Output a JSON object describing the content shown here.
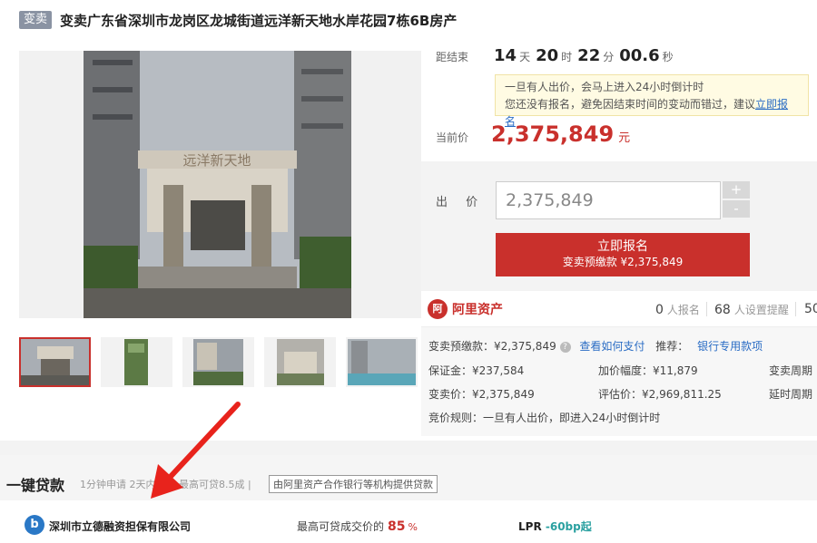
{
  "header": {
    "badge": "变卖",
    "title": "变卖广东省深圳市龙岗区龙城街道远洋新天地水岸花园7栋6B房产"
  },
  "photo": {
    "sign_text": "远洋新天地"
  },
  "countdown": {
    "label": "距结束",
    "days": "14",
    "days_unit": "天",
    "hours": "20",
    "hours_unit": "时",
    "minutes": "22",
    "minutes_unit": "分",
    "seconds": "00.6",
    "seconds_unit": "秒"
  },
  "notice": {
    "line1": "一旦有人出价，会马上进入24小时倒计时",
    "line2": "您还没有报名，避免因结束时间的变动而错过，建议",
    "link": "立即报名"
  },
  "current_price": {
    "label": "当前价",
    "value": "2,375,849",
    "unit": "元"
  },
  "bid": {
    "label": "出 价",
    "input_value": "2,375,849",
    "plus": "+",
    "minus": "-",
    "signup_label": "立即报名",
    "deposit_text": "变卖预缴款 ¥2,375,849"
  },
  "ali": {
    "logo": "阿",
    "name": "阿里资产",
    "signups_value": "0",
    "signups_label": "人报名",
    "reminders_value": "68",
    "reminders_label": "人设置提醒",
    "views_value": "50"
  },
  "details": {
    "prepay_label": "变卖预缴款：¥2,375,849",
    "help_icon": "?",
    "pay_link": "查看如何支付",
    "recommend_label": "推荐：",
    "bank_link": "银行专用款项",
    "deposit": "保证金：¥237,584",
    "increment": "加价幅度：¥11,879",
    "period": "变卖周期",
    "sale_price": "变卖价：¥2,375,849",
    "appraisal": "评估价：¥2,969,811.25",
    "extension": "延时周期",
    "rules": "竞价规则：一旦有人出价，即进入24小时倒计时"
  },
  "loan": {
    "title": "一键贷款",
    "subtitle": "1分钟申请 2天内放款 最高可贷8.5成 |",
    "tag": "由阿里资产合作银行等机构提供贷款",
    "logo": "b",
    "company": "深圳市立德融资担保有限公司",
    "max_label": "最高可贷成交价的",
    "max_value": "85",
    "max_unit": "%",
    "lpr_label": "LPR",
    "lpr_value": "-60bp起"
  },
  "colors": {
    "accent": "#c9302c",
    "link": "#2a6cc4"
  }
}
